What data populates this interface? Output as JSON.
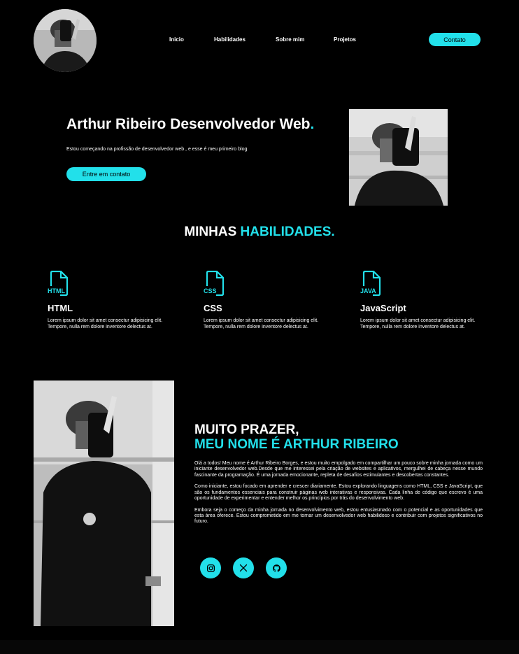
{
  "nav": {
    "items": [
      "Inicio",
      "Habilidades",
      "Sobre mim",
      "Projetos"
    ],
    "contact_label": "Contato"
  },
  "hero": {
    "title": "Arthur Ribeiro Desenvolvedor Web",
    "title_dot": ".",
    "subtitle": "Estou começando na profissão de desenvolvedor web , e esse é meu primeiro blog",
    "button_label": "Entre em contato"
  },
  "skills": {
    "title_prefix": "MINHAS ",
    "title_highlight": "HABILIDADES.",
    "items": [
      {
        "tag": "HTML",
        "name": "HTML",
        "desc": "Lorem ipsum dolor sit amet consectur adipisicing elit. Tempore, nulla rem dolore inventore delectus at."
      },
      {
        "tag": "CSS",
        "name": "CSS",
        "desc": "Lorem ipsum dolor sit amet consectur adipisicing elit. Tempore, nulla rem dolore inventore delectus at."
      },
      {
        "tag": "JAVA",
        "name": "JavaScript",
        "desc": "Lorem ipsum dolor sit amet consectur adipisicing elit. Tempore, nulla rem dolore inventore delectus at."
      }
    ]
  },
  "about": {
    "heading1": "MUITO PRAZER,",
    "heading2": "MEU NOME É ARTHUR RIBEIRO",
    "paragraphs": [
      "Olá a todos! Meu nome é Arthur Ribeiro Borges, e estou muito empolgado em compartilhar um pouco sobre minha jornada como um iniciante desenvolvedor web.Desde que me interessei pela criação de websites e aplicativos, mergulhei de cabeça nesse mundo fascinante da programação. É uma jornada emocionante, repleta de desafios estimulantes e descobertas constantes.",
      "Como iniciante, estou focado em aprender e crescer diariamente. Estou explorando linguagens como HTML, CSS e JavaScript, que são os fundamentos essenciais para construir páginas web interativas e responsivas. Cada linha de código que escrevo é uma oportunidade de experimentar e entender melhor os princípios por trás do desenvolvimento web.",
      "Embora seja o começo da minha jornada no desenvolvimento web, estou entusiasmado com o potencial e as oportunidades que esta área oferece. Estou comprometido em me tornar um desenvolvedor web habilidoso e contribuir com projetos significativos no futuro."
    ],
    "social_icons": [
      "instagram-icon",
      "x-icon",
      "github-icon"
    ]
  },
  "colors": {
    "accent": "#22e0ea",
    "background": "#000000",
    "text": "#ffffff"
  }
}
